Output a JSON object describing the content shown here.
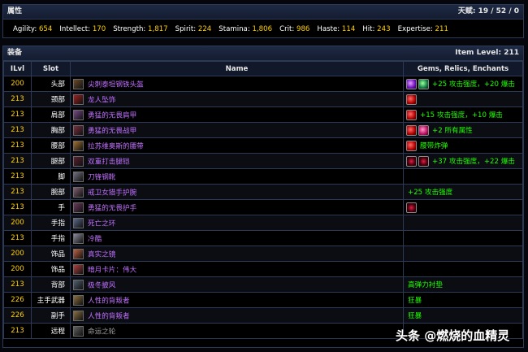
{
  "stats_panel": {
    "title": "属性",
    "talents_label": "天赋:",
    "talents_value": "19 / 52 / 0",
    "stats": [
      {
        "label": "Agility:",
        "value": "654"
      },
      {
        "label": "Intellect:",
        "value": "170"
      },
      {
        "label": "Strength:",
        "value": "1,817"
      },
      {
        "label": "Spirit:",
        "value": "224"
      },
      {
        "label": "Stamina:",
        "value": "1,806"
      },
      {
        "label": "Crit:",
        "value": "986"
      },
      {
        "label": "Haste:",
        "value": "114"
      },
      {
        "label": "Hit:",
        "value": "243"
      },
      {
        "label": "Expertise:",
        "value": "211"
      }
    ]
  },
  "gear_panel": {
    "title": "装备",
    "item_level_label": "Item Level:",
    "item_level_value": "211",
    "columns": [
      "ILvl",
      "Slot",
      "Name",
      "Gems, Relics, Enchants"
    ],
    "rows": [
      {
        "ilvl": "200",
        "slot": "头部",
        "name": "尖刺泰坦钢铁头盔",
        "icon": "helmet-icon",
        "icon_color": "#6b4a2a",
        "gems": [
          "purple",
          "green"
        ],
        "enchant": "+25 攻击强度，+20 爆击"
      },
      {
        "ilvl": "213",
        "slot": "颈部",
        "name": "龙人坠饰",
        "icon": "necklace-icon",
        "icon_color": "#a02020",
        "gems": [
          "red"
        ],
        "enchant": ""
      },
      {
        "ilvl": "213",
        "slot": "肩部",
        "name": "勇猛的无畏肩甲",
        "icon": "shoulder-icon",
        "icon_color": "#7a4a8a",
        "gems": [
          "red"
        ],
        "enchant": "+15 攻击强度，+10 爆击"
      },
      {
        "ilvl": "213",
        "slot": "胸部",
        "name": "勇猛的无畏战甲",
        "icon": "chest-icon",
        "icon_color": "#7a3040",
        "gems": [
          "red",
          "pink"
        ],
        "enchant": "+2 所有属性"
      },
      {
        "ilvl": "213",
        "slot": "腰部",
        "name": "拉苏维奥斯的腰带",
        "icon": "belt-icon",
        "icon_color": "#a07030",
        "gems": [
          "red"
        ],
        "enchant": "腰带炸弹"
      },
      {
        "ilvl": "213",
        "slot": "腿部",
        "name": "双重打击腿铠",
        "icon": "legs-icon",
        "icon_color": "#5a2030",
        "gems": [
          "dark",
          "dark"
        ],
        "enchant": "+37 攻击强度，+22 爆击"
      },
      {
        "ilvl": "213",
        "slot": "脚",
        "name": "刀锋钢靴",
        "icon": "boots-icon",
        "icon_color": "#707080",
        "gems": [],
        "enchant": ""
      },
      {
        "ilvl": "213",
        "slot": "腕部",
        "name": "戒卫女猎手护腕",
        "icon": "bracers-icon",
        "icon_color": "#806070",
        "gems": [],
        "enchant": "+25 攻击强度"
      },
      {
        "ilvl": "213",
        "slot": "手",
        "name": "勇猛的无畏护手",
        "icon": "gloves-icon",
        "icon_color": "#6a3a5a",
        "gems": [
          "dark"
        ],
        "enchant": ""
      },
      {
        "ilvl": "200",
        "slot": "手指",
        "name": "死亡之环",
        "icon": "ring-icon",
        "icon_color": "#5a6a8a",
        "gems": [],
        "enchant": ""
      },
      {
        "ilvl": "213",
        "slot": "手指",
        "name": "冷酷",
        "icon": "ring-icon",
        "icon_color": "#8a8a9a",
        "gems": [],
        "enchant": ""
      },
      {
        "ilvl": "200",
        "slot": "饰品",
        "name": "真实之镜",
        "icon": "trinket-icon",
        "icon_color": "#c06040",
        "gems": [],
        "enchant": ""
      },
      {
        "ilvl": "200",
        "slot": "饰品",
        "name": "暗月卡片：伟大",
        "icon": "card-icon",
        "icon_color": "#b04040",
        "gems": [],
        "enchant": ""
      },
      {
        "ilvl": "213",
        "slot": "背部",
        "name": "极冬披风",
        "icon": "cloak-icon",
        "icon_color": "#506070",
        "gems": [],
        "enchant": "高弹力衬垫"
      },
      {
        "ilvl": "226",
        "slot": "主手武器",
        "name": "人性的背叛者",
        "icon": "axe-icon",
        "icon_color": "#8a7040",
        "gems": [],
        "enchant": "狂暴"
      },
      {
        "ilvl": "226",
        "slot": "副手",
        "name": "人性的背叛者",
        "icon": "axe-icon",
        "icon_color": "#8a7040",
        "gems": [],
        "enchant": "狂暴"
      },
      {
        "ilvl": "213",
        "slot": "远程",
        "name": "命运之轮",
        "icon": "ranged-icon",
        "icon_color": "#606060",
        "gems": [],
        "enchant": "",
        "gray": true
      }
    ]
  },
  "watermark": "头条 @燃烧的血精灵"
}
